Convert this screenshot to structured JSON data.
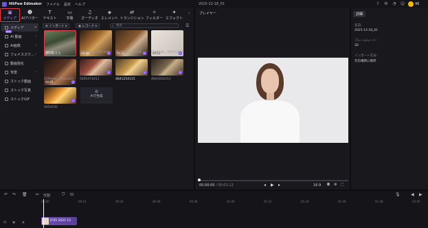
{
  "titlebar": {
    "app_name": "HitPaw Edimakor",
    "menus": [
      "ファイル",
      "設定",
      "ヘルプ"
    ],
    "project_title": "2025-12-18_01",
    "credit": "96"
  },
  "tools": [
    {
      "label": "メディア",
      "icon": "media-icon"
    },
    {
      "label": "AIアバター",
      "icon": "avatar-icon"
    },
    {
      "label": "テキスト",
      "icon": "text-icon"
    },
    {
      "label": "字幕",
      "icon": "subtitle-icon"
    },
    {
      "label": "オーディオ",
      "icon": "audio-icon"
    },
    {
      "label": "エレメント",
      "icon": "element-icon"
    },
    {
      "label": "トランジション",
      "icon": "transition-icon"
    },
    {
      "label": "フィルター",
      "icon": "filter-icon"
    },
    {
      "label": "エフェクト",
      "icon": "effect-icon"
    }
  ],
  "sidebar": [
    "メディア",
    "AI 動画",
    "AI画像",
    "フェイススワ...",
    "動画強化",
    "背景",
    "ストック動画",
    "ストック写真",
    "ストックGIF"
  ],
  "media_toolbar": {
    "import": "インポート",
    "record": "レコード",
    "search_placeholder": "検索"
  },
  "media": [
    {
      "caption": "クリスマス",
      "duration": "00:05",
      "bold": false
    },
    {
      "caption": "(289e8e...c967442)",
      "duration": "00:08",
      "bold": false
    },
    {
      "caption": "85777427-1-208",
      "duration": "00:12",
      "bold": false
    },
    {
      "caption": "(5d89d8...00601669",
      "duration": "00:12",
      "bold": false
    },
    {
      "caption": "(299e8c...79bcea5)",
      "duration": "00:05",
      "bold": false
    },
    {
      "caption": "5465474411",
      "duration": "",
      "bold": false
    },
    {
      "caption": "4841254115",
      "duration": "",
      "bold": true
    },
    {
      "caption": "4841654151",
      "duration": "",
      "bold": false
    },
    {
      "caption": "4454102",
      "duration": "",
      "bold": false
    }
  ],
  "ai_generate": "AIで生成",
  "player": {
    "label": "プレイヤー",
    "time_current": "00:00:00",
    "time_total": "/ 00:01:12",
    "aspect": "16:9"
  },
  "props": {
    "tab": "詳細",
    "name_label": "名前:",
    "name_value": "2025-12-18_01",
    "fps_label": "フレームレート:",
    "fps_value": "30",
    "export_label": "インポート方法:",
    "export_value": "元の場所に保存"
  },
  "timeline": {
    "split": "分割",
    "ticks": [
      "00:00",
      "00:12",
      "00:24",
      "00:36",
      "00:48",
      "01:00",
      "01:12",
      "01:24",
      "01:36",
      "01:48",
      "02:00"
    ],
    "clip_label": "0:05 2025 12"
  }
}
